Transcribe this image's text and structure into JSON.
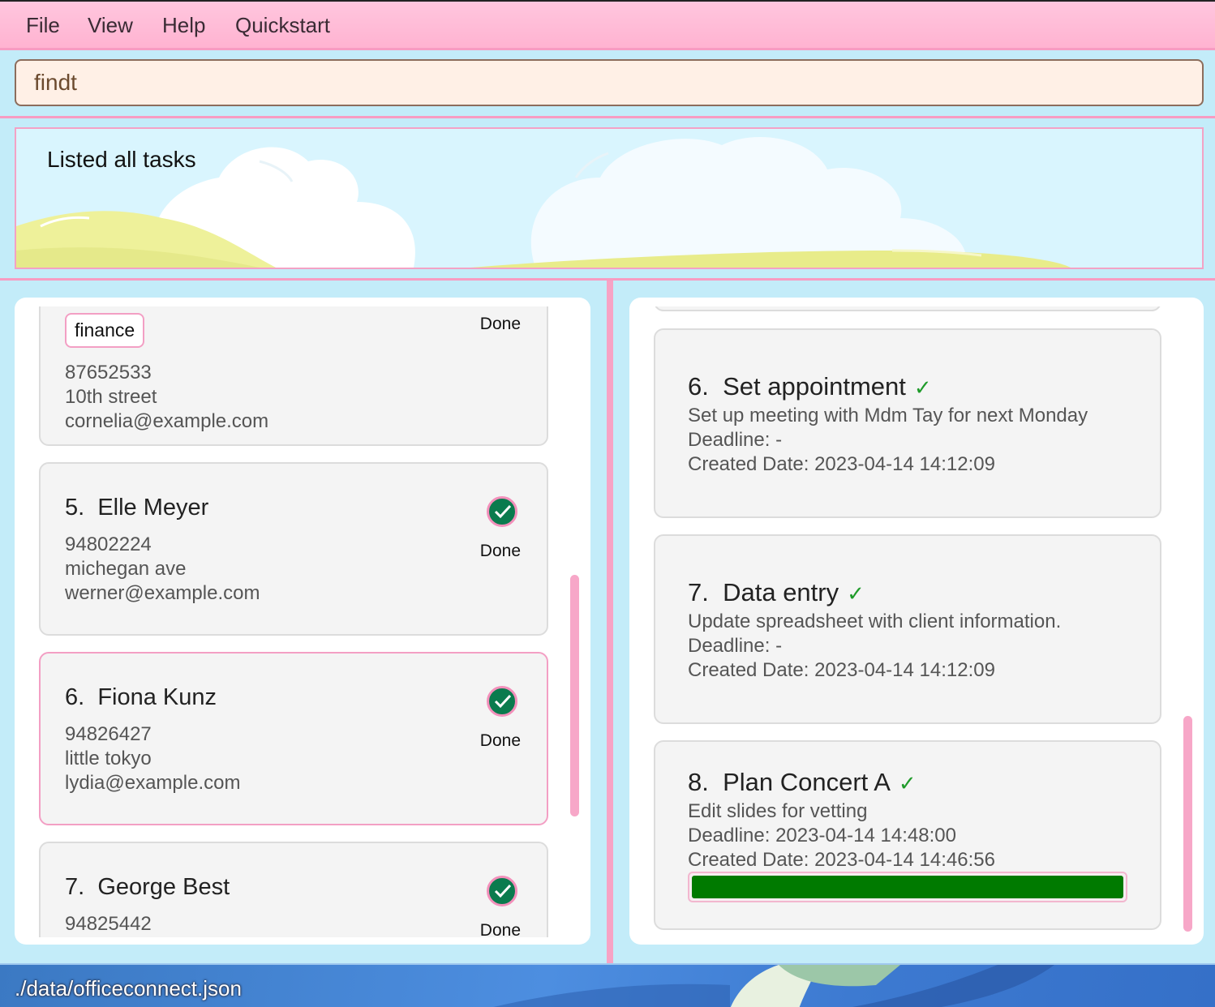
{
  "menu": [
    "File",
    "View",
    "Help",
    "Quickstart"
  ],
  "command": {
    "value": "findt"
  },
  "result": {
    "text": "Listed all tasks"
  },
  "persons": [
    {
      "tag": "finance",
      "phone": "87652533",
      "address": "10th street",
      "email": "cornelia@example.com",
      "status": "Done"
    },
    {
      "index": "5.",
      "name": "Elle Meyer",
      "phone": "94802224",
      "address": "michegan ave",
      "email": "werner@example.com",
      "status": "Done"
    },
    {
      "index": "6.",
      "name": "Fiona Kunz",
      "phone": "94826427",
      "address": "little tokyo",
      "email": "lydia@example.com",
      "status": "Done"
    },
    {
      "index": "7.",
      "name": "George Best",
      "phone": "94825442",
      "status": "Done"
    }
  ],
  "tasks": [
    {
      "index": "6.",
      "title": "Set appointment",
      "check": "✓",
      "description": "Set up meeting with Mdm Tay for next Monday",
      "deadline": "Deadline: -",
      "created": "Created Date: 2023-04-14 14:12:09"
    },
    {
      "index": "7.",
      "title": "Data entry",
      "check": "✓",
      "description": "Update spreadsheet with client information.",
      "deadline": "Deadline: -",
      "created": "Created Date: 2023-04-14 14:12:09"
    },
    {
      "index": "8.",
      "title": "Plan Concert A",
      "check": "✓",
      "description": "Edit slides for vetting",
      "deadline": "Deadline: 2023-04-14 14:48:00",
      "created": "Created Date: 2023-04-14 14:46:56",
      "progress": 1.0
    }
  ],
  "colors": {
    "done_green": "#0a7b4e",
    "progress_green": "#007a00",
    "accent_pink": "#f7a3c5"
  },
  "statusbar": {
    "path": "./data/officeconnect.json"
  }
}
